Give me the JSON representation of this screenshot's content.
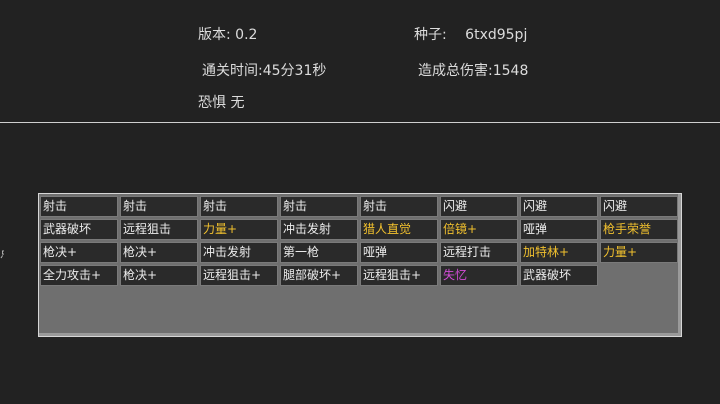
{
  "stats": {
    "version_label": "版本:",
    "version_value": "0.2",
    "seed_label": "种子:",
    "seed_value": "6txd95pj",
    "clear_time_label": "通关时间:",
    "clear_time_value": "45分31秒",
    "total_damage_label": "造成总伤害:",
    "total_damage_value": "1548",
    "fear_label": "恐惧",
    "fear_value": "无"
  },
  "edge_glyph": "点",
  "deck": {
    "rows": [
      [
        {
          "name": "射击",
          "rarity": "white"
        },
        {
          "name": "射击",
          "rarity": "white"
        },
        {
          "name": "射击",
          "rarity": "white"
        },
        {
          "name": "射击",
          "rarity": "white"
        },
        {
          "name": "射击",
          "rarity": "white"
        },
        {
          "name": "闪避",
          "rarity": "white"
        },
        {
          "name": "闪避",
          "rarity": "white"
        },
        {
          "name": "闪避",
          "rarity": "white"
        }
      ],
      [
        {
          "name": "武器破坏",
          "rarity": "white"
        },
        {
          "name": "远程狙击",
          "rarity": "white"
        },
        {
          "name": "力量+",
          "rarity": "yellow"
        },
        {
          "name": "冲击发射",
          "rarity": "white"
        },
        {
          "name": "猎人直觉",
          "rarity": "yellow"
        },
        {
          "name": "倍镜+",
          "rarity": "yellow"
        },
        {
          "name": "哑弹",
          "rarity": "white"
        },
        {
          "name": "枪手荣誉",
          "rarity": "yellow"
        }
      ],
      [
        {
          "name": "枪决+",
          "rarity": "white"
        },
        {
          "name": "枪决+",
          "rarity": "white"
        },
        {
          "name": "冲击发射",
          "rarity": "white"
        },
        {
          "name": "第一枪",
          "rarity": "white"
        },
        {
          "name": "哑弹",
          "rarity": "white"
        },
        {
          "name": "远程打击",
          "rarity": "white"
        },
        {
          "name": "加特林+",
          "rarity": "yellow"
        },
        {
          "name": "力量+",
          "rarity": "yellow"
        }
      ],
      [
        {
          "name": "全力攻击+",
          "rarity": "white"
        },
        {
          "name": "枪决+",
          "rarity": "white"
        },
        {
          "name": "远程狙击+",
          "rarity": "white"
        },
        {
          "name": "腿部破坏+",
          "rarity": "white"
        },
        {
          "name": "远程狙击+",
          "rarity": "white"
        },
        {
          "name": "失忆",
          "rarity": "purple"
        },
        {
          "name": "武器破坏",
          "rarity": "white"
        }
      ]
    ]
  }
}
